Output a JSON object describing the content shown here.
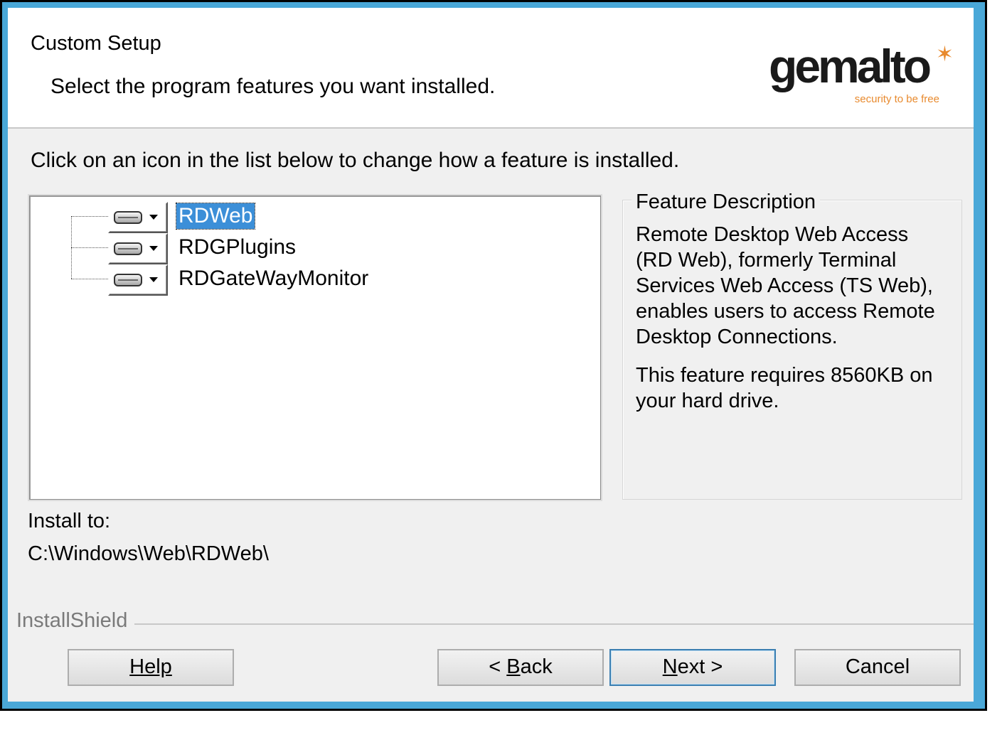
{
  "header": {
    "title": "Custom Setup",
    "subtitle": "Select the program features you want installed.",
    "logo": {
      "brand": "gemalto",
      "tagline": "security to be free",
      "accent": "#e88a2e"
    }
  },
  "instruction": "Click on an icon in the list below to change how a feature is installed.",
  "features": [
    {
      "label": "RDWeb",
      "selected": true
    },
    {
      "label": "RDGPlugins",
      "selected": false
    },
    {
      "label": "RDGateWayMonitor",
      "selected": false
    }
  ],
  "description": {
    "title": "Feature Description",
    "text": "Remote Desktop Web Access (RD Web), formerly Terminal Services Web Access (TS Web), enables users to access Remote Desktop Connections.",
    "requirement": "This feature requires 8560KB on your hard drive."
  },
  "install": {
    "label": "Install to:",
    "path": "C:\\Windows\\Web\\RDWeb\\"
  },
  "footer": {
    "brand": "InstallShield"
  },
  "buttons": {
    "help": "Help",
    "back_prefix": "< ",
    "back_hot": "B",
    "back_rest": "ack",
    "next_hot": "N",
    "next_rest": "ext >",
    "cancel": "Cancel"
  },
  "colors": {
    "frame": "#4aa8d8",
    "selection": "#3c8fd8",
    "dialog": "#f0f0f0"
  }
}
